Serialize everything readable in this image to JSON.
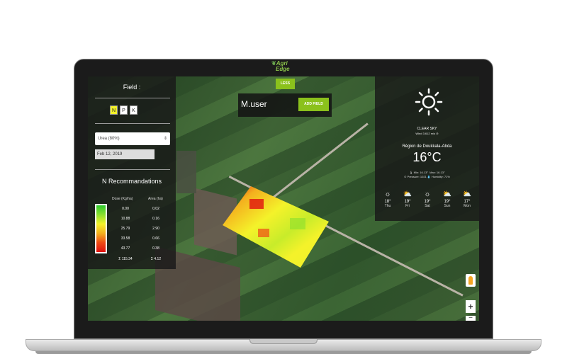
{
  "app": {
    "logo_text_1": "Agri",
    "logo_text_2": "Edge"
  },
  "left_panel": {
    "field_title": "Field :",
    "nutrients": [
      "N",
      "P",
      "K"
    ],
    "active_nutrient": "N",
    "fertilizer_select": "Urea (80%)",
    "date": "Feb 12, 2019",
    "recommendations_title": "N Recommandations",
    "col_dose": "Dose (Kg/ha)",
    "col_area": "Area (ha)",
    "rows": [
      {
        "dose": "0.00",
        "area": "0.02"
      },
      {
        "dose": "10.88",
        "area": "0.16"
      },
      {
        "dose": "25.79",
        "area": "2.90"
      },
      {
        "dose": "33.58",
        "area": "0.66"
      },
      {
        "dose": "43.77",
        "area": "0.38"
      }
    ],
    "total_dose": "Σ 115.34",
    "total_area": "Σ 4.12",
    "legend_colors": [
      "#2ec92e",
      "#8be02e",
      "#f4f22a",
      "#f4b01e",
      "#f04a14",
      "#e0110e"
    ]
  },
  "top": {
    "less_label": "LESS",
    "user_name": "M.user",
    "add_field_label": "ADD FIELD",
    "accent": "#8bc11c"
  },
  "weather": {
    "icon": "sun-icon",
    "condition": "CLEAR SKY",
    "wind": "Wind 3.612 m/s",
    "region": "Région de Doukkala-Abda",
    "temperature": "16°C",
    "min": "Min: 16.13°",
    "max": "Max: 16.13°",
    "pressure": "Pressure: 1021",
    "humidity": "Humidity: 71%",
    "forecast": [
      {
        "temp": "18°",
        "day": "Thu",
        "icon": "sun-icon"
      },
      {
        "temp": "19°",
        "day": "Fri",
        "icon": "partly-cloudy-icon"
      },
      {
        "temp": "19°",
        "day": "Sat",
        "icon": "sun-icon"
      },
      {
        "temp": "19°",
        "day": "Sun",
        "icon": "partly-cloudy-icon"
      },
      {
        "temp": "17°",
        "day": "Mon",
        "icon": "partly-cloudy-icon"
      }
    ]
  },
  "map_controls": {
    "zoom_in": "+",
    "zoom_out": "−"
  }
}
